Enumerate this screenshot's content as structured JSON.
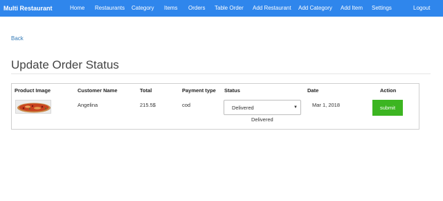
{
  "navbar": {
    "brand": "Multi Restaurant",
    "links": [
      "Home",
      "Restaurants",
      "Category",
      "Items",
      "Orders",
      "Table Order",
      "Add Restaurant",
      "Add Category",
      "Add Item",
      "Settings"
    ],
    "logout": "Logout"
  },
  "back_label": "Back",
  "page_title": "Update Order Status",
  "table": {
    "headers": [
      "Product Image",
      "Customer Name",
      "Total",
      "Payment type",
      "Status",
      "Date",
      "Action"
    ],
    "rows": [
      {
        "customer": "Angelina",
        "total": "215.5$",
        "payment": "cod",
        "status_selected": "Delivered",
        "status_text": "Delivered",
        "date": "Mar 1, 2018",
        "action": "submit"
      }
    ]
  },
  "colors": {
    "navbar": "#2f86ec",
    "submit": "#3cb521",
    "link": "#337ab7"
  },
  "icons": {
    "select_caret": "▼"
  }
}
